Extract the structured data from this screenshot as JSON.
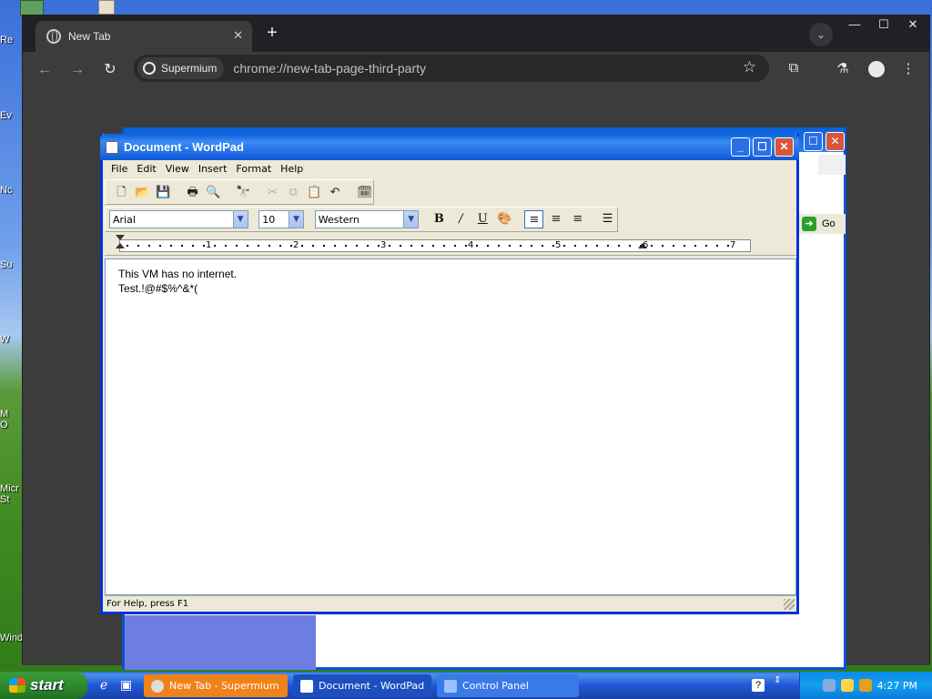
{
  "desktop": {
    "icon_labels": [
      "Re",
      "Ev",
      "Nc",
      "Su",
      "W",
      "M\nO",
      "Micr\nSt",
      "Wind"
    ]
  },
  "chrome": {
    "tab_title": "New Tab",
    "chip_label": "Supermium",
    "url": "chrome://new-tab-page-third-party",
    "icons": {
      "back": "arrow-left-icon",
      "forward": "arrow-right-icon",
      "reload": "reload-icon",
      "bookmark": "star-icon",
      "extensions": "puzzle-icon",
      "labs": "flask-icon",
      "profile": "person-icon",
      "menu": "kebab-icon"
    }
  },
  "control_panel": {
    "go_label": "Go"
  },
  "wordpad": {
    "title": "Document - WordPad",
    "menu": [
      "File",
      "Edit",
      "View",
      "Insert",
      "Format",
      "Help"
    ],
    "font": "Arial",
    "size": "10",
    "script": "Western",
    "ruler_numbers": [
      "1",
      "2",
      "3",
      "4",
      "5",
      "6",
      "7"
    ],
    "lines": [
      "This VM has no internet.",
      "Test.!@#$%^&*("
    ],
    "status": "For Help, press F1"
  },
  "taskbar": {
    "start_label": "start",
    "tasks": [
      "New Tab - Supermium",
      "Document - WordPad",
      "Control Panel"
    ],
    "clock": "4:27 PM"
  },
  "colors": {
    "xp_blue": "#0a5fd8",
    "chrome_dark": "#3c3c3c",
    "active_task": "#f0821a"
  }
}
